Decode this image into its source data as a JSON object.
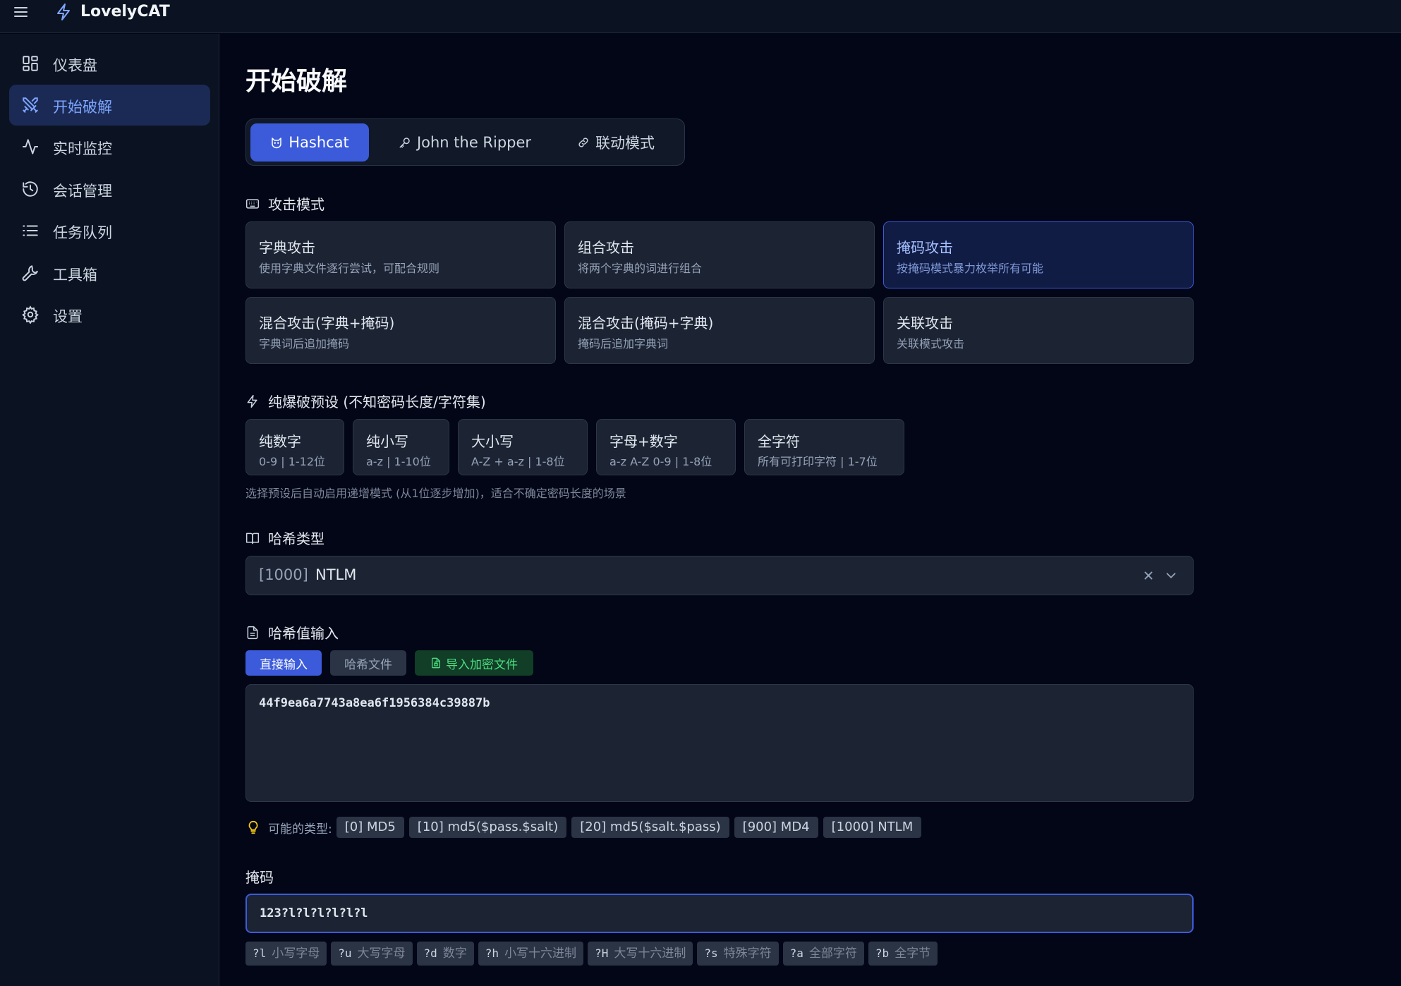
{
  "app": {
    "name": "LovelyCAT",
    "accent": "#3b5bdb"
  },
  "sidebar": {
    "items": [
      {
        "label": "仪表盘",
        "icon": "dashboard-icon"
      },
      {
        "label": "开始破解",
        "icon": "swords-icon",
        "active": true
      },
      {
        "label": "实时监控",
        "icon": "activity-icon"
      },
      {
        "label": "会话管理",
        "icon": "history-icon"
      },
      {
        "label": "任务队列",
        "icon": "list-icon"
      },
      {
        "label": "工具箱",
        "icon": "wrench-icon"
      },
      {
        "label": "设置",
        "icon": "gear-icon"
      }
    ]
  },
  "main": {
    "title": "开始破解",
    "tabs": [
      {
        "label": "Hashcat",
        "icon": "cat-icon",
        "active": true
      },
      {
        "label": "John the Ripper",
        "icon": "key-icon"
      },
      {
        "label": "联动模式",
        "icon": "link-icon"
      }
    ],
    "attack_mode": {
      "label": "攻击模式",
      "modes": [
        {
          "title": "字典攻击",
          "desc": "使用字典文件逐行尝试，可配合规则"
        },
        {
          "title": "组合攻击",
          "desc": "将两个字典的词进行组合"
        },
        {
          "title": "掩码攻击",
          "desc": "按掩码模式暴力枚举所有可能",
          "active": true
        },
        {
          "title": "混合攻击(字典+掩码)",
          "desc": "字典词后追加掩码"
        },
        {
          "title": "混合攻击(掩码+字典)",
          "desc": "掩码后追加字典词"
        },
        {
          "title": "关联攻击",
          "desc": "关联模式攻击"
        }
      ]
    },
    "presets": {
      "label": "纯爆破预设 (不知密码长度/字符集)",
      "items": [
        {
          "title": "纯数字",
          "desc": "0-9 | 1-12位"
        },
        {
          "title": "纯小写",
          "desc": "a-z | 1-10位"
        },
        {
          "title": "大小写",
          "desc": "A-Z + a-z | 1-8位"
        },
        {
          "title": "字母+数字",
          "desc": "a-z A-Z 0-9 | 1-8位"
        },
        {
          "title": "全字符",
          "desc": "所有可打印字符 | 1-7位"
        }
      ],
      "hint": "选择预设后自动启用递增模式 (从1位逐步增加)，适合不确定密码长度的场景"
    },
    "hash_type": {
      "label": "哈希类型",
      "code": "[1000]",
      "value": "NTLM"
    },
    "hash_input": {
      "label": "哈希值输入",
      "buttons": {
        "direct": "直接输入",
        "file": "哈希文件",
        "import": "导入加密文件"
      },
      "value": "44f9ea6a7743a8ea6f1956384c39887b",
      "possible_label": "可能的类型:",
      "possible_types": [
        "[0] MD5",
        "[10] md5($pass.$salt)",
        "[20] md5($salt.$pass)",
        "[900] MD4",
        "[1000] NTLM"
      ]
    },
    "mask": {
      "label": "掩码",
      "value": "123?l?l?l?l?l?l",
      "charsets": [
        {
          "key": "?l",
          "label": "小写字母"
        },
        {
          "key": "?u",
          "label": "大写字母"
        },
        {
          "key": "?d",
          "label": "数字"
        },
        {
          "key": "?h",
          "label": "小写十六进制"
        },
        {
          "key": "?H",
          "label": "大写十六进制"
        },
        {
          "key": "?s",
          "label": "特殊字符"
        },
        {
          "key": "?a",
          "label": "全部字符"
        },
        {
          "key": "?b",
          "label": "全字节"
        }
      ]
    }
  }
}
